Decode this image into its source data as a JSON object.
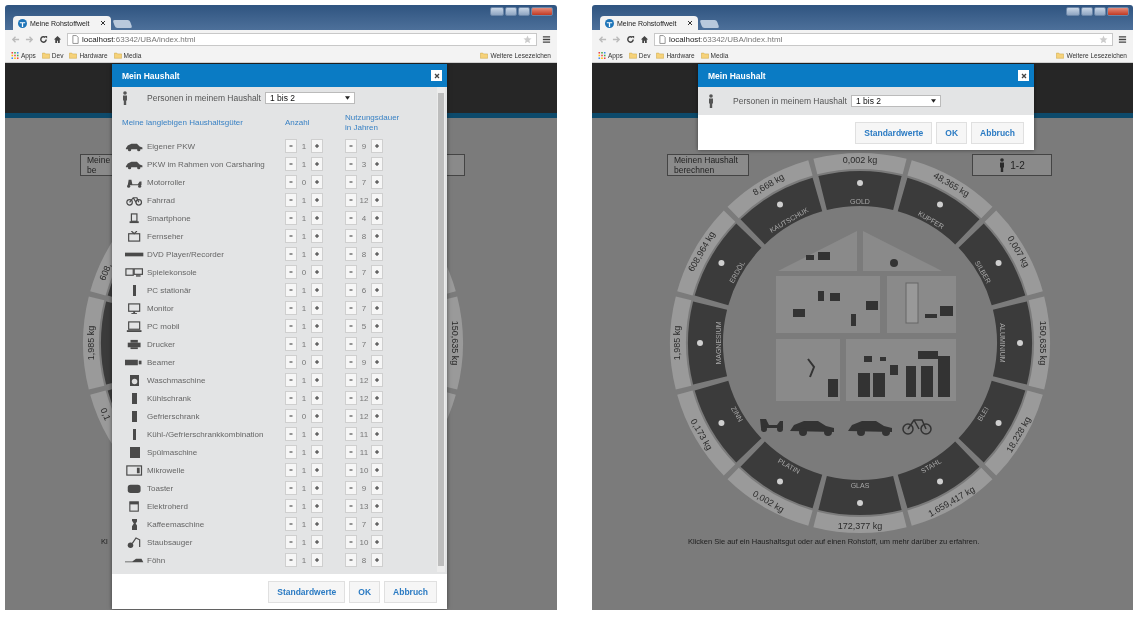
{
  "windows": [
    {
      "tab": "Meine Rohstoffwelt",
      "address": "**localhost**:63342/UBA/index.html",
      "bookmarks": [
        {
          "label": "Apps",
          "kind": "apps"
        },
        {
          "label": "Dev",
          "kind": "folder"
        },
        {
          "label": "Hardware",
          "kind": "folder"
        },
        {
          "label": "Media",
          "kind": "folder"
        }
      ],
      "other_bookmarks": "Weitere Lesezeichen",
      "page": {
        "calc_button": [
          "Meine",
          "be"
        ],
        "ring_fragments": [
          "608,",
          "1,985 kg",
          "0,1",
          "150,635 kg"
        ],
        "hint": "Kl"
      },
      "dialog": {
        "title": "Mein Haushalt",
        "persons": {
          "label": "Personen in meinem Haushalt",
          "value": "1 bis 2"
        },
        "table": {
          "columns": [
            "Meine langlebigen Haushaltsgüter",
            "Anzahl",
            "Nutzungsdauer in Jahren"
          ],
          "rows": [
            {
              "name": "Eigener PKW",
              "count": "1",
              "years": "9"
            },
            {
              "name": "PKW im Rahmen von Carsharing",
              "count": "1",
              "years": "3"
            },
            {
              "name": "Motorroller",
              "count": "0",
              "years": "7"
            },
            {
              "name": "Fahrrad",
              "count": "1",
              "years": "12"
            },
            {
              "name": "Smartphone",
              "count": "1",
              "years": "4"
            },
            {
              "name": "Fernseher",
              "count": "1",
              "years": "8"
            },
            {
              "name": "DVD Player/Recorder",
              "count": "1",
              "years": "8"
            },
            {
              "name": "Spielekonsole",
              "count": "0",
              "years": "7"
            },
            {
              "name": "PC stationär",
              "count": "1",
              "years": "6"
            },
            {
              "name": "Monitor",
              "count": "1",
              "years": "7"
            },
            {
              "name": "PC mobil",
              "count": "1",
              "years": "5"
            },
            {
              "name": "Drucker",
              "count": "1",
              "years": "7"
            },
            {
              "name": "Beamer",
              "count": "0",
              "years": "9"
            },
            {
              "name": "Waschmaschine",
              "count": "1",
              "years": "12"
            },
            {
              "name": "Kühlschrank",
              "count": "1",
              "years": "12"
            },
            {
              "name": "Gefrierschrank",
              "count": "0",
              "years": "12"
            },
            {
              "name": "Kühl-/Gefrierschrankkombination",
              "count": "1",
              "years": "11"
            },
            {
              "name": "Spülmaschine",
              "count": "1",
              "years": "11"
            },
            {
              "name": "Mikrowelle",
              "count": "1",
              "years": "10"
            },
            {
              "name": "Toaster",
              "count": "1",
              "years": "9"
            },
            {
              "name": "Elektroherd",
              "count": "1",
              "years": "13"
            },
            {
              "name": "Kaffeemaschine",
              "count": "1",
              "years": "7"
            },
            {
              "name": "Staubsauger",
              "count": "1",
              "years": "10"
            },
            {
              "name": "Föhn",
              "count": "1",
              "years": "8"
            }
          ]
        },
        "buttons": [
          "Standardwerte",
          "OK",
          "Abbruch"
        ]
      }
    },
    {
      "tab": "Meine Rohstoffwelt",
      "address": "**localhost**:63342/UBA/index.html",
      "bookmarks": [
        {
          "label": "Apps",
          "kind": "apps"
        },
        {
          "label": "Dev",
          "kind": "folder"
        },
        {
          "label": "Hardware",
          "kind": "folder"
        },
        {
          "label": "Media",
          "kind": "folder"
        }
      ],
      "other_bookmarks": "Weitere Lesezeichen",
      "page": {
        "calc_button": [
          "Meinen Haushalt",
          "berechnen"
        ],
        "persons_button": "1-2",
        "ring": [
          {
            "material": "GOLD",
            "value": "0,002 kg"
          },
          {
            "material": "KUPFER",
            "value": "48,365 kg"
          },
          {
            "material": "SILBER",
            "value": "0,007 kg"
          },
          {
            "material": "ALUMINIUM",
            "value": "150,635 kg"
          },
          {
            "material": "BLEI",
            "value": "18,228 kg"
          },
          {
            "material": "STAHL",
            "value": "1.659,417 kg"
          },
          {
            "material": "GLAS",
            "value": "172,377 kg"
          },
          {
            "material": "PLATIN",
            "value": "0,002 kg"
          },
          {
            "material": "ZINN",
            "value": "0,173 kg"
          },
          {
            "material": "MAGNESIUM",
            "value": "1,985 kg"
          },
          {
            "material": "ERDÖL",
            "value": "608,964 kg"
          },
          {
            "material": "KAUTSCHUK",
            "value": "8,668 kg"
          }
        ],
        "hint": "Klicken Sie auf ein Haushaltsgut oder auf einen Rohstoff, um mehr darüber zu erfahren."
      },
      "dialog": {
        "title": "Mein Haushalt",
        "persons": {
          "label": "Personen in meinem Haushalt",
          "value": "1 bis 2"
        },
        "buttons": [
          "Standardwerte",
          "OK",
          "Abbruch"
        ]
      }
    }
  ]
}
